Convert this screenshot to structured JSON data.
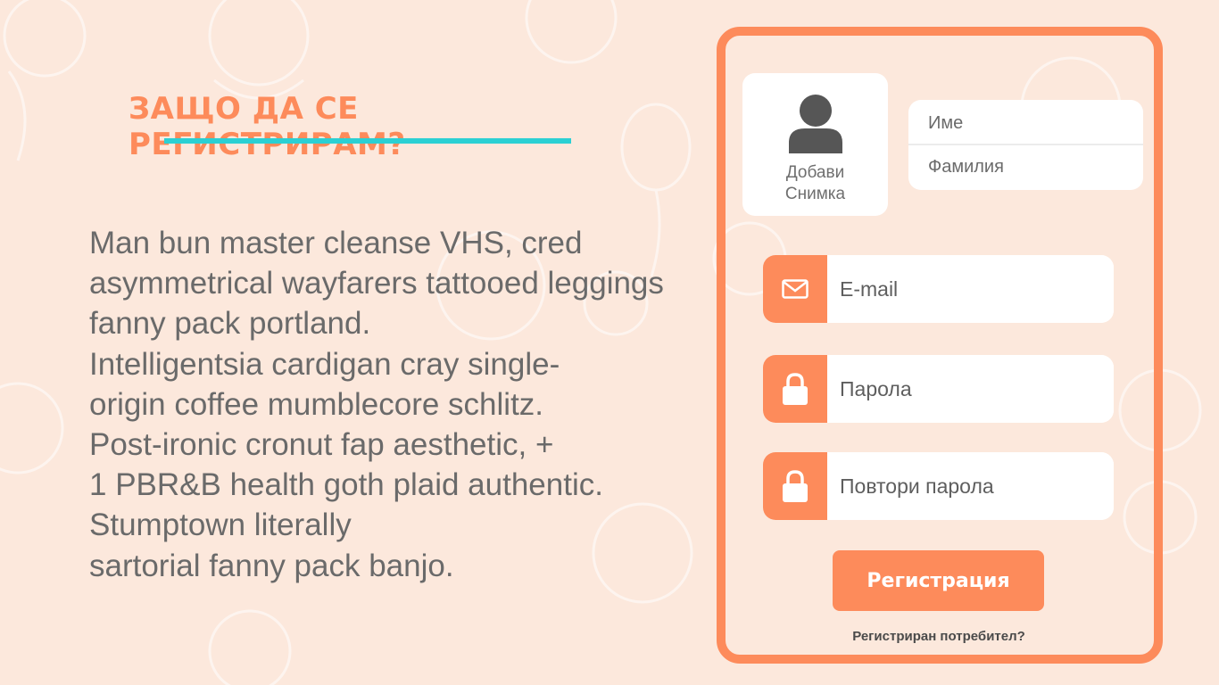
{
  "info": {
    "heading": "ЗАЩО ДА СЕ РЕГИСТРИРАМ?",
    "lines": [
      "Man bun master cleanse VHS, cred",
      "asymmetrical wayfarers tattooed leggings",
      "fanny pack portland.",
      "Intelligentsia cardigan cray single-",
      "origin coffee mumblecore schlitz.",
      "Post-ironic cronut fap aesthetic, +",
      "1 PBR&B health goth plaid authentic.",
      "Stumptown literally",
      "sartorial fanny pack banjo."
    ]
  },
  "form": {
    "photo": {
      "line1": "Добави",
      "line2": "Снимка",
      "icon": "user-silhouette-icon"
    },
    "first_name_placeholder": "Име",
    "last_name_placeholder": "Фамилия",
    "email_placeholder": "E-mail",
    "password_placeholder": "Парола",
    "repeat_password_placeholder": "Повтори парола",
    "submit_label": "Регистрация",
    "login_link": "Регистриран потребител?"
  },
  "colors": {
    "background": "#fce8dc",
    "accent": "#fd8b5b",
    "underline": "#2bd0d3",
    "text": "#6a6a6a"
  }
}
